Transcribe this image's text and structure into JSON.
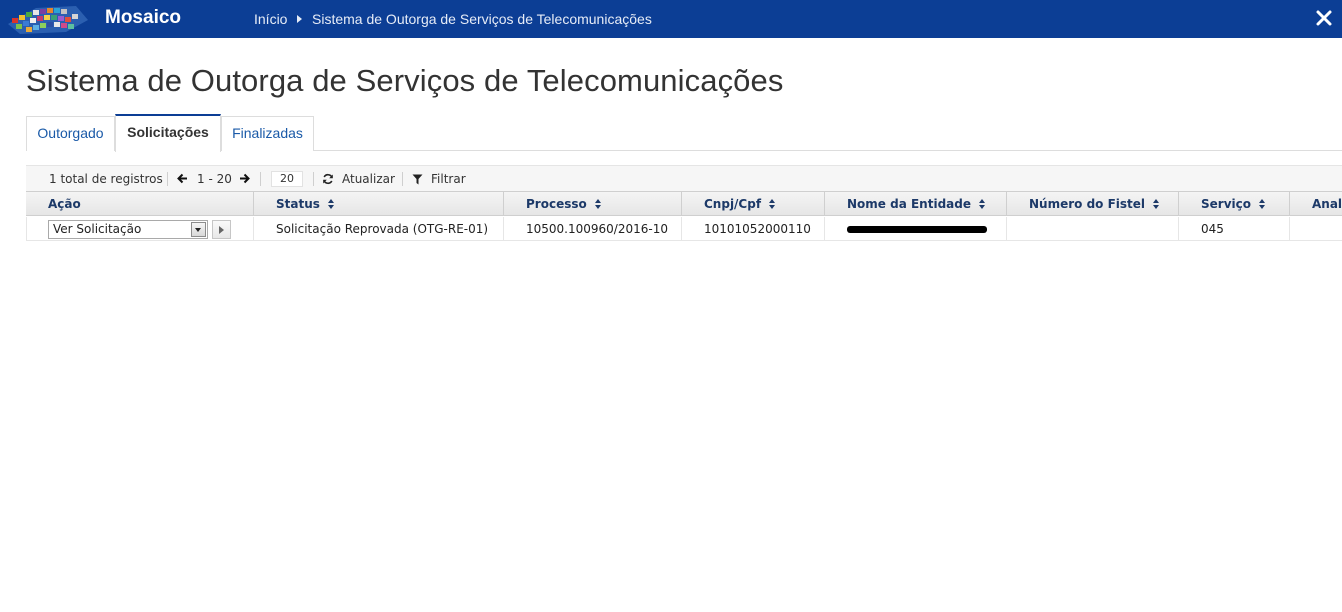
{
  "app": {
    "brand": "Mosaico",
    "colors": {
      "header_bg": "#0c3e95",
      "link": "#1a5aa8",
      "header_text": "#1c3968"
    }
  },
  "breadcrumb": {
    "home": "Início",
    "current": "Sistema de Outorga de Serviços de Telecomunicações"
  },
  "page": {
    "title": "Sistema de Outorga de Serviços de Telecomunicações"
  },
  "tabs": [
    {
      "label": "Outorgado",
      "active": false
    },
    {
      "label": "Solicitações",
      "active": true
    },
    {
      "label": "Finalizadas",
      "active": false
    }
  ],
  "toolbar": {
    "total": "1 total de registros",
    "range": "1 - 20",
    "page_size": "20",
    "refresh_label": "Atualizar",
    "filter_label": "Filtrar"
  },
  "table": {
    "columns": [
      "Ação",
      "Status",
      "Processo",
      "Cnpj/Cpf",
      "Nome da Entidade",
      "Número do Fistel",
      "Serviço",
      "Anal"
    ],
    "rows": [
      {
        "action": "Ver Solicitação",
        "status": "Solicitação Reprovada (OTG-RE-01)",
        "processo": "10500.100960/2016-10",
        "cnpj": "10101052000110",
        "nome": "",
        "fistel": "",
        "servico": "045",
        "anal": ""
      }
    ]
  }
}
